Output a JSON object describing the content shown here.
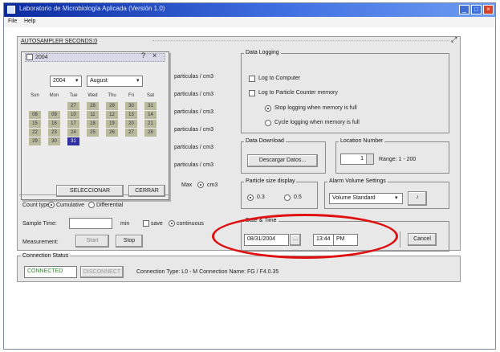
{
  "window": {
    "title": "Laboratorio de Microbiología Aplicada (Versión 1.0)",
    "controls": [
      "_",
      "□",
      "×"
    ]
  },
  "menu": [
    "File",
    "Help"
  ],
  "panel": {
    "header": "AUTOSAMPLER   SECONDS:0"
  },
  "calendar": {
    "label": "2004",
    "year": "2004",
    "month": "August",
    "weekdays": [
      "Sun",
      "Mon",
      "Tue",
      "Wed",
      "Thu",
      "Fri",
      "Sat"
    ],
    "days": [
      [
        "",
        "",
        "27",
        "28",
        "29",
        "30",
        "31"
      ],
      [
        "08",
        "09",
        "10",
        "11",
        "12",
        "13",
        "14"
      ],
      [
        "15",
        "16",
        "17",
        "18",
        "19",
        "20",
        "21"
      ],
      [
        "22",
        "23",
        "24",
        "25",
        "26",
        "27",
        "28"
      ],
      [
        "29",
        "30",
        "31",
        "",
        "",
        "",
        ""
      ]
    ],
    "selected_day": "31",
    "ok_label": "SELECCIONAR",
    "close_label": "CERRAR"
  },
  "ports": [
    "particulas / cm3",
    "particulas / cm3",
    "particulas / cm3",
    "particulas / cm3",
    "particulas / cm3",
    "particulas / cm3"
  ],
  "max_label": "Max",
  "max_unit": "cm3",
  "count_type": {
    "label": "Count type:",
    "opt1": "Cumulative",
    "opt2": "Differential"
  },
  "sample_time": {
    "label": "Sample Time:",
    "unit": "min",
    "check_label": "save",
    "radio_label": "continuous"
  },
  "measurement": {
    "label": "Measurement:",
    "start": "Start",
    "stop": "Stop"
  },
  "data_logging": {
    "title": "Data Logging",
    "opt1": "Log to Computer",
    "opt2": "Log to Particle Counter memory",
    "sub1": "Stop logging when memory is full",
    "sub2": "Cycle logging when memory is full"
  },
  "data_download": {
    "title": "Data Download",
    "button": "Descargar Datos..."
  },
  "location_number": {
    "title": "Location Number",
    "value": "1",
    "range": "Range: 1 - 200"
  },
  "particle_size": {
    "title": "Particle size display",
    "opt1": "0.3",
    "opt2": "0.5"
  },
  "alarm_volume": {
    "title": "Alarm Volume Settings",
    "select": "Volume Standard"
  },
  "date_time": {
    "title": "Date & Time",
    "date": "08/31/2004",
    "time": "13:44",
    "ampm": "PM",
    "cancel": "Cancel"
  },
  "connection": {
    "title": "Connection Status",
    "status": "CONNECTED",
    "disconnect": "DISCONNECT",
    "info": "Connection Type:  L0 - M     Connection Name: FG / F4.0.35"
  },
  "colors": {
    "title_start": "#0a2a9e",
    "title_end": "#6e9cf2",
    "status_green": "#2a8a2a",
    "highlight_red": "#e01010"
  }
}
